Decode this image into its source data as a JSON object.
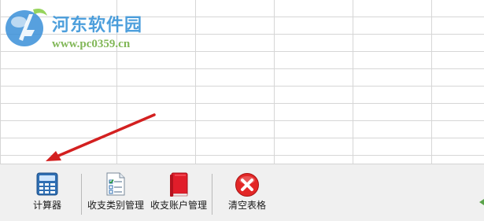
{
  "watermark": {
    "title": "河东软件园",
    "url": "www.pc0359.cn"
  },
  "toolbar": {
    "buttons": [
      {
        "label": "计算器",
        "icon": "calculator-icon"
      },
      {
        "label": "收支类别管理",
        "icon": "checklist-document-icon"
      },
      {
        "label": "收支账户管理",
        "icon": "red-book-icon"
      },
      {
        "label": "清空表格",
        "icon": "red-x-circle-icon"
      }
    ]
  },
  "colors": {
    "arrow": "#d32020",
    "watermark_title": "#2f8fd6",
    "watermark_url": "#6cab3a",
    "toolbar_bg": "#f0f0f0",
    "grid_line": "#d6d6d6"
  }
}
